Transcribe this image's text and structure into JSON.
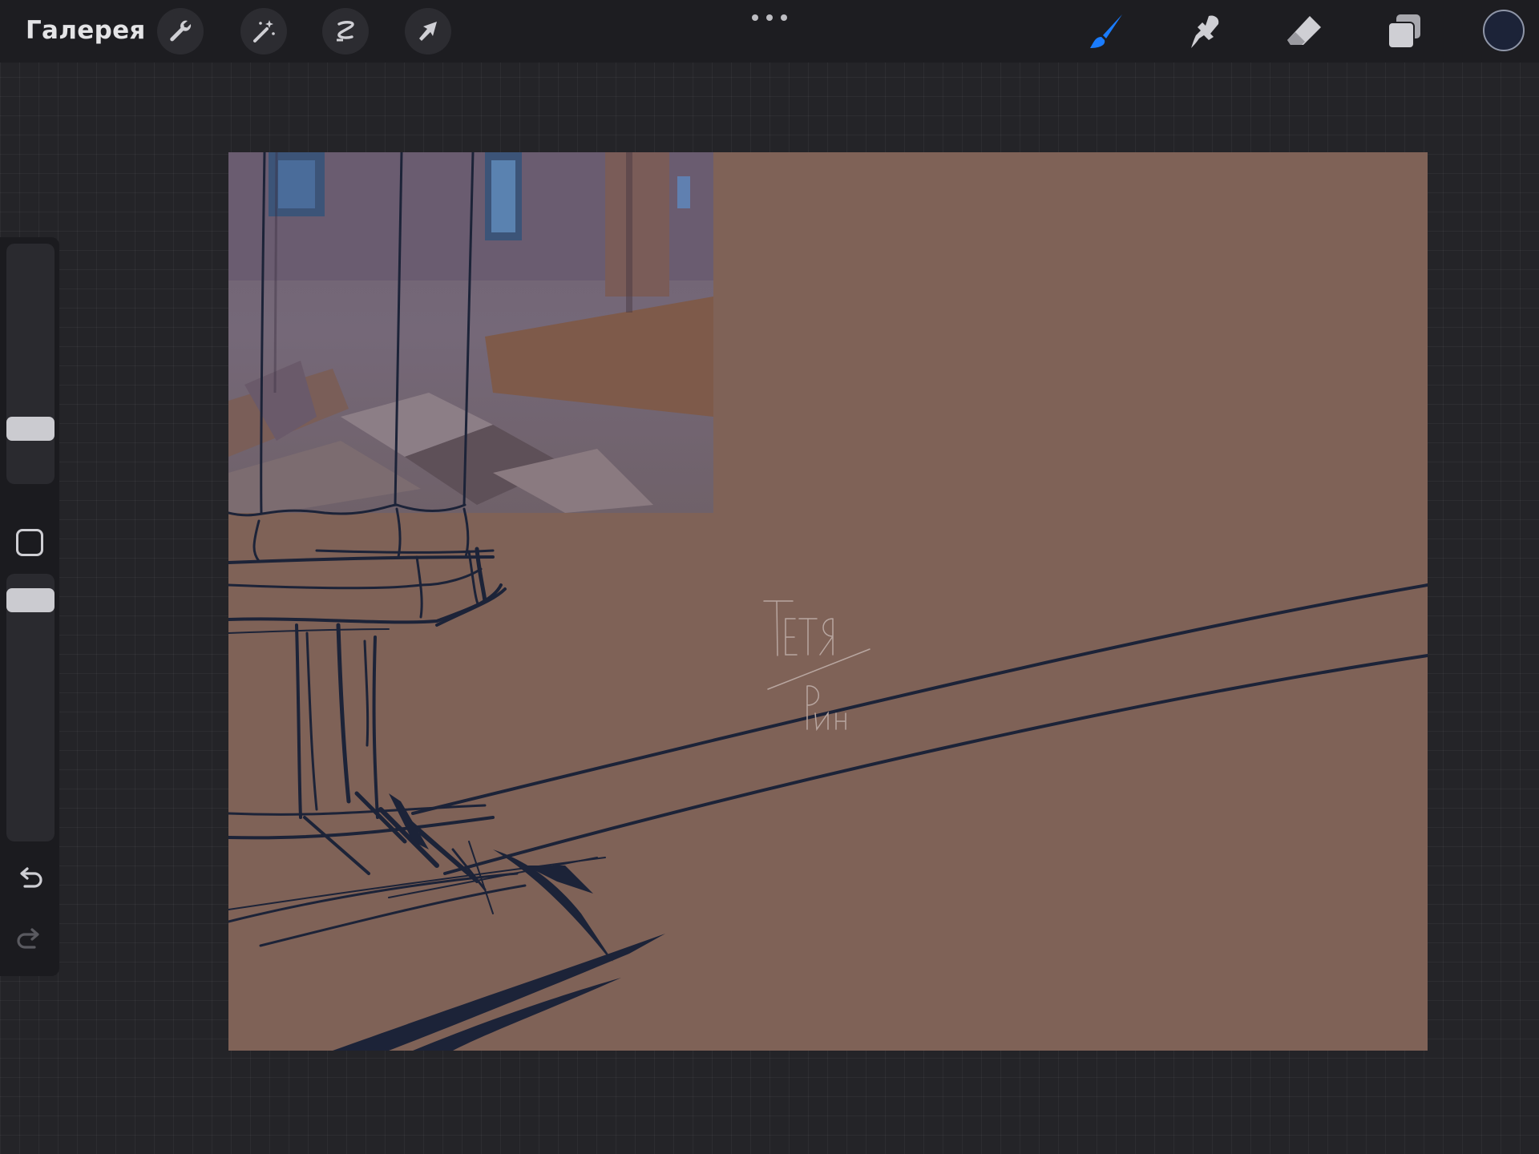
{
  "topbar": {
    "gallery_label": "Галерея",
    "tools_left": [
      "wrench-icon",
      "magic-wand-icon",
      "selection-icon",
      "transform-arrow-icon"
    ],
    "more_icon": "ellipsis-icon",
    "tools_right": [
      "brush-icon",
      "smudge-icon",
      "eraser-icon",
      "layers-icon"
    ],
    "active_tool": "brush",
    "active_color": "#1c2338",
    "accent_color": "#1a7cff"
  },
  "sidebar": {
    "brush_size_level": 0.2,
    "opacity_level": 0.94,
    "modify_icon": "square-modify-icon",
    "undo_icon": "undo-icon",
    "redo_icon": "redo-icon"
  },
  "canvas": {
    "background_color": "#7f6257",
    "stroke_color": "#1c2338",
    "reference_photo": "cathedral-interior",
    "handwritten_text": [
      "Тетя",
      "Рин"
    ]
  }
}
